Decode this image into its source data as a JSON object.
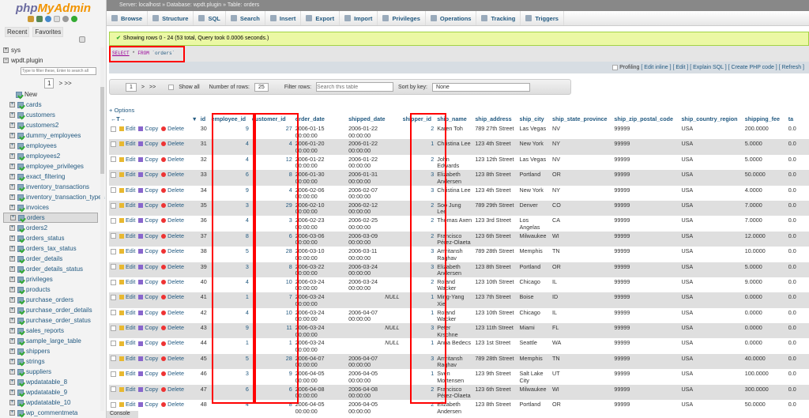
{
  "sidebar": {
    "logo_php": "php",
    "logo_brand": "MyAdmin",
    "recent": "Recent",
    "favorites": "Favorites",
    "databases": [
      {
        "name": "sys"
      },
      {
        "name": "wpdt.plugin"
      }
    ],
    "filter_placeholder": "Type to filter these, Enter to search all",
    "page": "1",
    "page_nav": "> >>",
    "new_label": "New",
    "tables": [
      "cards",
      "customers",
      "customers2",
      "dummy_employees",
      "employees",
      "employees2",
      "employee_privileges",
      "exact_filtering",
      "inventory_transactions",
      "inventory_transaction_types",
      "invoices",
      "orders",
      "orders2",
      "orders_status",
      "orders_tax_status",
      "order_details",
      "order_details_status",
      "privileges",
      "products",
      "purchase_orders",
      "purchase_order_details",
      "purchase_order_status",
      "sales_reports",
      "sample_large_table",
      "shippers",
      "strings",
      "suppliers",
      "wpdatatable_8",
      "wpdatatable_9",
      "wpdatatable_10",
      "wp_commentmeta"
    ],
    "selected": "orders"
  },
  "breadcrumb": "Server: localhost » Database: wpdt.plugin » Table: orders",
  "tabs": [
    "Browse",
    "Structure",
    "SQL",
    "Search",
    "Insert",
    "Export",
    "Import",
    "Privileges",
    "Operations",
    "Tracking",
    "Triggers"
  ],
  "message": "Showing rows 0 - 24 (53 total, Query took 0.0006 seconds.)",
  "sql": {
    "select": "SELECT",
    "star": " * ",
    "from": "FROM",
    "table": " `orders`"
  },
  "profiling": {
    "label": "Profiling",
    "links": "[ Edit inline ] [ Edit ] [ Explain SQL ] [ Create PHP code ] [ Refresh ]"
  },
  "nav": {
    "page": "1",
    "next": ">",
    "last": ">>",
    "show_all": "Show all",
    "rows_label": "Number of rows:",
    "rows": "25",
    "filter_label": "Filter rows:",
    "filter_placeholder": "Search this table",
    "sort_label": "Sort by key:",
    "sort": "None"
  },
  "options": "+ Options",
  "actions": {
    "edit": "Edit",
    "copy": "Copy",
    "delete": "Delete"
  },
  "columns": [
    "id",
    "employee_id",
    "customer_id",
    "order_date",
    "shipped_date",
    "shipper_id",
    "ship_name",
    "ship_address",
    "ship_city",
    "ship_state_province",
    "ship_zip_postal_code",
    "ship_country_region",
    "shipping_fee",
    "ta"
  ],
  "rows": [
    [
      "30",
      "9",
      "27",
      "2006-01-15 00:00:00",
      "2006-01-22 00:00:00",
      "2",
      "Karen Toh",
      "789 27th Street",
      "Las Vegas",
      "NV",
      "99999",
      "USA",
      "200.0000",
      "0.0"
    ],
    [
      "31",
      "4",
      "4",
      "2006-01-20 00:00:00",
      "2006-01-22 00:00:00",
      "1",
      "Christina Lee",
      "123 4th Street",
      "New York",
      "NY",
      "99999",
      "USA",
      "5.0000",
      "0.0"
    ],
    [
      "32",
      "4",
      "12",
      "2006-01-22 00:00:00",
      "2006-01-22 00:00:00",
      "2",
      "John Edwards",
      "123 12th Street",
      "Las Vegas",
      "NV",
      "99999",
      "USA",
      "5.0000",
      "0.0"
    ],
    [
      "33",
      "6",
      "8",
      "2006-01-30 00:00:00",
      "2006-01-31 00:00:00",
      "3",
      "Elizabeth Andersen",
      "123 8th Street",
      "Portland",
      "OR",
      "99999",
      "USA",
      "50.0000",
      "0.0"
    ],
    [
      "34",
      "9",
      "4",
      "2006-02-06 00:00:00",
      "2006-02-07 00:00:00",
      "3",
      "Christina Lee",
      "123 4th Street",
      "New York",
      "NY",
      "99999",
      "USA",
      "4.0000",
      "0.0"
    ],
    [
      "35",
      "3",
      "29",
      "2006-02-10 00:00:00",
      "2006-02-12 00:00:00",
      "2",
      "Soo Jung Lee",
      "789 29th Street",
      "Denver",
      "CO",
      "99999",
      "USA",
      "7.0000",
      "0.0"
    ],
    [
      "36",
      "4",
      "3",
      "2006-02-23 00:00:00",
      "2006-02-25 00:00:00",
      "2",
      "Thomas Axen",
      "123 3rd Street",
      "Los Angelas",
      "CA",
      "99999",
      "USA",
      "7.0000",
      "0.0"
    ],
    [
      "37",
      "8",
      "6",
      "2006-03-06 00:00:00",
      "2006-03-09 00:00:00",
      "2",
      "Francisco Pérez-Olaeta",
      "123 6th Street",
      "Milwaukee",
      "WI",
      "99999",
      "USA",
      "12.0000",
      "0.0"
    ],
    [
      "38",
      "5",
      "28",
      "2006-03-10 00:00:00",
      "2006-03-11 00:00:00",
      "3",
      "Amritansh Raghav",
      "789 28th Street",
      "Memphis",
      "TN",
      "99999",
      "USA",
      "10.0000",
      "0.0"
    ],
    [
      "39",
      "3",
      "8",
      "2006-03-22 00:00:00",
      "2006-03-24 00:00:00",
      "3",
      "Elizabeth Andersen",
      "123 8th Street",
      "Portland",
      "OR",
      "99999",
      "USA",
      "5.0000",
      "0.0"
    ],
    [
      "40",
      "4",
      "10",
      "2006-03-24 00:00:00",
      "2006-03-24 00:00:00",
      "2",
      "Roland Wacker",
      "123 10th Street",
      "Chicago",
      "IL",
      "99999",
      "USA",
      "9.0000",
      "0.0"
    ],
    [
      "41",
      "1",
      "7",
      "2006-03-24 00:00:00",
      "NULL",
      "1",
      "Ming-Yang Xie",
      "123 7th Street",
      "Boise",
      "ID",
      "99999",
      "USA",
      "0.0000",
      "0.0"
    ],
    [
      "42",
      "4",
      "10",
      "2006-03-24 00:00:00",
      "2006-04-07 00:00:00",
      "1",
      "Roland Wacker",
      "123 10th Street",
      "Chicago",
      "IL",
      "99999",
      "USA",
      "0.0000",
      "0.0"
    ],
    [
      "43",
      "9",
      "11",
      "2006-03-24 00:00:00",
      "NULL",
      "3",
      "Peter Krschne",
      "123 11th Street",
      "Miami",
      "FL",
      "99999",
      "USA",
      "0.0000",
      "0.0"
    ],
    [
      "44",
      "1",
      "1",
      "2006-03-24 00:00:00",
      "NULL",
      "1",
      "Anna Bedecs",
      "123 1st Street",
      "Seattle",
      "WA",
      "99999",
      "USA",
      "0.0000",
      "0.0"
    ],
    [
      "45",
      "5",
      "28",
      "2006-04-07 00:00:00",
      "2006-04-07 00:00:00",
      "3",
      "Amritansh Raghav",
      "789 28th Street",
      "Memphis",
      "TN",
      "99999",
      "USA",
      "40.0000",
      "0.0"
    ],
    [
      "46",
      "3",
      "9",
      "2006-04-05 00:00:00",
      "2006-04-05 00:00:00",
      "1",
      "Sven Mortensen",
      "123 9th Street",
      "Salt Lake City",
      "UT",
      "99999",
      "USA",
      "100.0000",
      "0.0"
    ],
    [
      "47",
      "6",
      "6",
      "2006-04-08 00:00:00",
      "2006-04-08 00:00:00",
      "2",
      "Francisco Pérez-Olaeta",
      "123 6th Street",
      "Milwaukee",
      "WI",
      "99999",
      "USA",
      "300.0000",
      "0.0"
    ],
    [
      "48",
      "4",
      "8",
      "2006-04-05 00:00:00",
      "2006-04-05 00:00:00",
      "2",
      "Elizabeth Andersen",
      "123 8th Street",
      "Portland",
      "OR",
      "99999",
      "USA",
      "50.0000",
      "0.0"
    ]
  ],
  "console": "Console",
  "colors": {
    "highlight": "#ff0000",
    "link": "#235a81",
    "success_bg": "#ebf8a4"
  }
}
